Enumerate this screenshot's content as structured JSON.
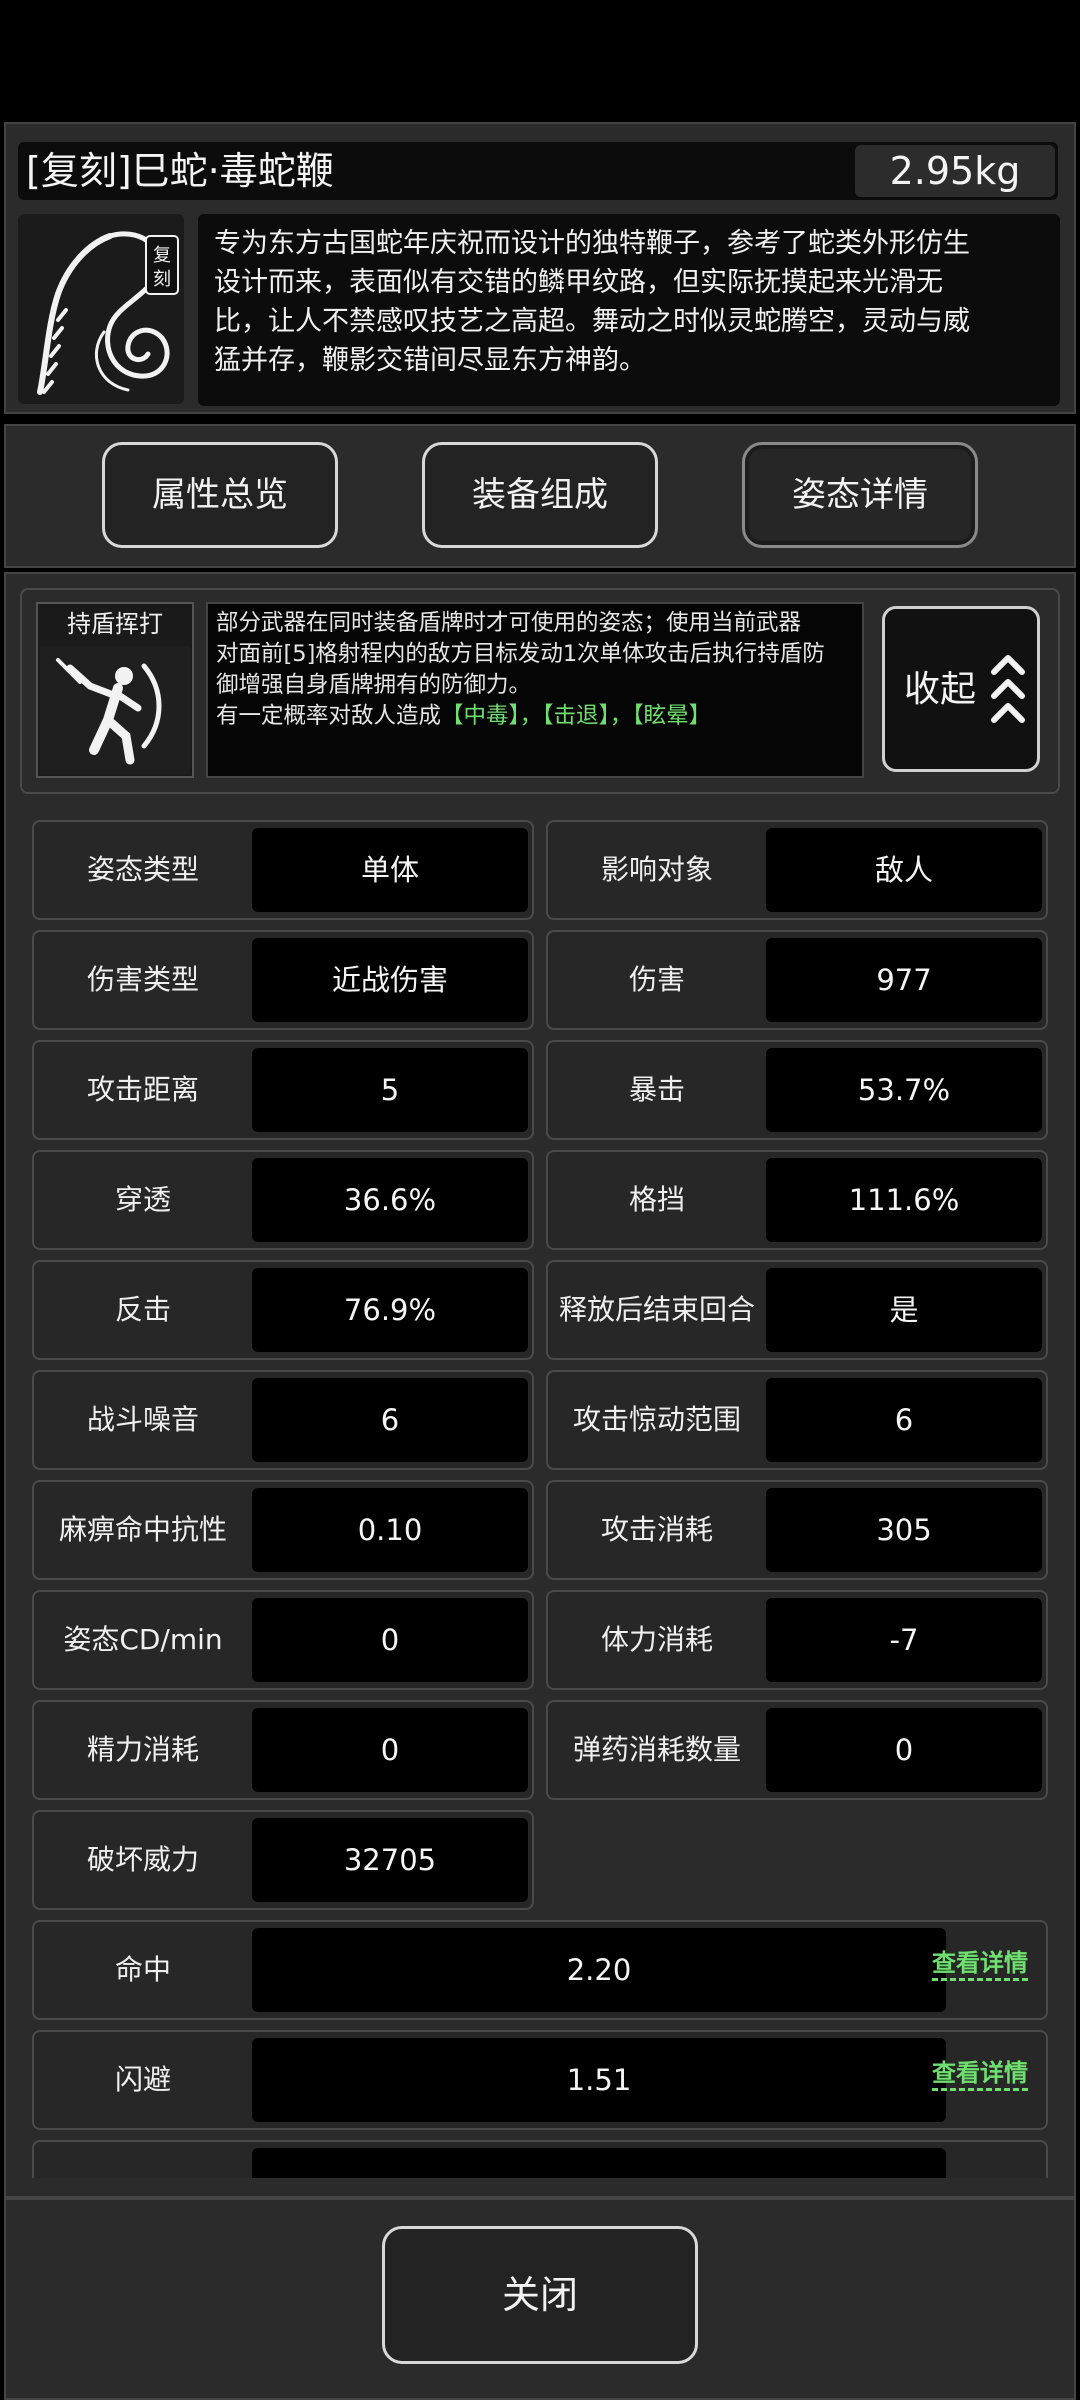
{
  "item": {
    "title": "[复刻]巳蛇·毒蛇鞭",
    "weight": "2.95kg",
    "badge": "复刻",
    "description_lines": [
      "专为东方古国蛇年庆祝而设计的独特鞭子，参考了蛇类外形仿生",
      "设计而来，表面似有交错的鳞甲纹路，但实际抚摸起来光滑无",
      "比，让人不禁感叹技艺之高超。舞动之时似灵蛇腾空，灵动与威",
      "猛并存，鞭影交错间尽显东方神韵。"
    ],
    "icon": "snake-whip-icon"
  },
  "tabs": [
    {
      "label": "属性总览"
    },
    {
      "label": "装备组成"
    },
    {
      "label": "姿态详情"
    }
  ],
  "active_tab": "姿态详情",
  "skill": {
    "name": "持盾挥打",
    "icon": "shield-swing-icon",
    "desc_lines": [
      "部分武器在同时装备盾牌时才可使用的姿态；使用当前武器",
      "对面前[5]格射程内的敌方目标发动1次单体攻击后执行持盾防",
      "御增强自身盾牌拥有的防御力。"
    ],
    "effect_prefix": "有一定概率对敌人造成",
    "effects": [
      "【中毒】",
      "，",
      "【击退】",
      "，",
      "【眩晕】"
    ],
    "collapse_label": "收起",
    "collapse_icon": "chevron-up-triple-icon"
  },
  "stats": [
    {
      "label": "姿态类型",
      "value": "单体"
    },
    {
      "label": "影响对象",
      "value": "敌人"
    },
    {
      "label": "伤害类型",
      "value": "近战伤害"
    },
    {
      "label": "伤害",
      "value": "977"
    },
    {
      "label": "攻击距离",
      "value": "5"
    },
    {
      "label": "暴击",
      "value": "53.7%"
    },
    {
      "label": "穿透",
      "value": "36.6%"
    },
    {
      "label": "格挡",
      "value": "111.6%"
    },
    {
      "label": "反击",
      "value": "76.9%"
    },
    {
      "label": "释放后结束回合",
      "value": "是"
    },
    {
      "label": "战斗噪音",
      "value": "6"
    },
    {
      "label": "攻击惊动范围",
      "value": "6"
    },
    {
      "label": "麻痹命中抗性",
      "value": "0.10"
    },
    {
      "label": "攻击消耗",
      "value": "305"
    },
    {
      "label": "姿态CD/min",
      "value": "0"
    },
    {
      "label": "体力消耗",
      "value": "-7"
    },
    {
      "label": "精力消耗",
      "value": "0"
    },
    {
      "label": "弹药消耗数量",
      "value": "0"
    },
    {
      "label": "破坏威力",
      "value": "32705"
    }
  ],
  "wide_stats": [
    {
      "label": "命中",
      "value": "2.20",
      "link": "查看详情"
    },
    {
      "label": "闪避",
      "value": "1.51",
      "link": "查看详情"
    },
    {
      "label": "",
      "value": "",
      "link": ""
    }
  ],
  "close_label": "关闭",
  "colors": {
    "accent_green": "#6fe06f",
    "panel_bg": "#2b2b2b",
    "cell_bg": "#000000"
  }
}
